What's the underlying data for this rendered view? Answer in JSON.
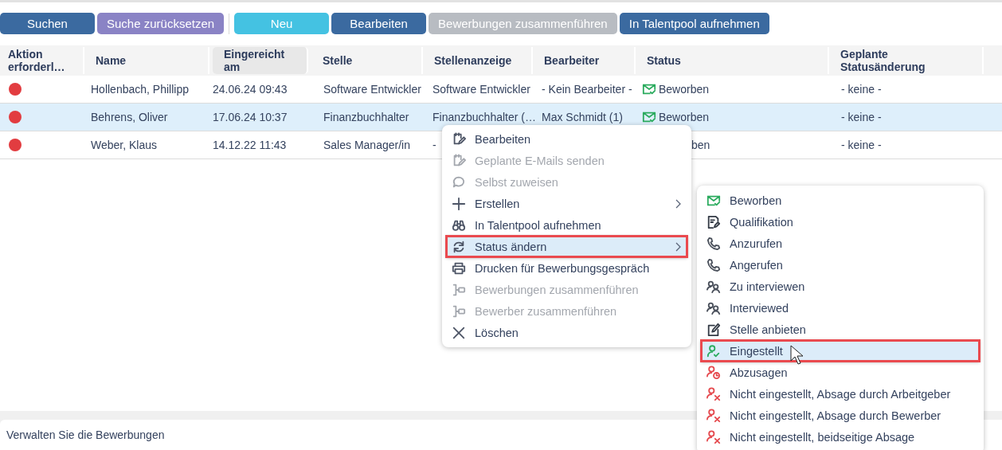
{
  "toolbar": [
    {
      "label": "Suchen",
      "kind": "primary",
      "disabled": false
    },
    {
      "label": "Suche zurücksetzen",
      "kind": "secondary",
      "disabled": false
    },
    {
      "label": "Neu",
      "kind": "accent",
      "disabled": false
    },
    {
      "label": "Bearbeiten",
      "kind": "primary",
      "disabled": false
    },
    {
      "label": "Bewerbungen zusammenführen",
      "kind": "primary",
      "disabled": true
    },
    {
      "label": "In Talentpool aufnehmen",
      "kind": "primary",
      "disabled": false
    }
  ],
  "table": {
    "columns": [
      {
        "label": "Aktion erforderl…",
        "sorted": false
      },
      {
        "label": "Name",
        "sorted": false
      },
      {
        "label": "Eingereicht am",
        "sorted": true
      },
      {
        "label": "Stelle",
        "sorted": false
      },
      {
        "label": "Stellenanzeige",
        "sorted": false
      },
      {
        "label": "Bearbeiter",
        "sorted": false
      },
      {
        "label": "Status",
        "sorted": false
      },
      {
        "label": "Geplante Statusänderung",
        "sorted": false
      }
    ],
    "rows": [
      {
        "action_required": true,
        "selected": false,
        "name": "Hollenbach, Phillipp",
        "submitted": "24.06.24 09:43",
        "position": "Software Entwickler",
        "job_ad": "Software Entwickler",
        "assignee": "- Kein Bearbeiter -",
        "status": {
          "text": "Beworben",
          "icon": true
        },
        "planned": "- keine -"
      },
      {
        "action_required": true,
        "selected": true,
        "name": "Behrens, Oliver",
        "submitted": "17.06.24 10:37",
        "position": "Finanzbuchhalter",
        "job_ad": "Finanzbuchhalter (…",
        "assignee": "Max Schmidt (1)",
        "status": {
          "text": "Beworben",
          "icon": true
        },
        "planned": "- keine -"
      },
      {
        "action_required": true,
        "selected": false,
        "name": "Weber, Klaus",
        "submitted": "14.12.22 11:43",
        "position": "Sales Manager/in",
        "job_ad": "-",
        "status": {
          "text": "ben",
          "icon": false
        },
        "planned": "- keine -"
      }
    ]
  },
  "context_menu": {
    "items": [
      {
        "label": "Bearbeiten",
        "disabled": false,
        "submenu": false,
        "selected": false
      },
      {
        "label": "Geplante E-Mails senden",
        "disabled": true,
        "submenu": false,
        "selected": false
      },
      {
        "label": "Selbst zuweisen",
        "disabled": true,
        "submenu": false,
        "selected": false
      },
      {
        "label": "Erstellen",
        "disabled": false,
        "submenu": true,
        "selected": false
      },
      {
        "label": "In Talentpool aufnehmen",
        "disabled": false,
        "submenu": false,
        "selected": false
      },
      {
        "label": "Status ändern",
        "disabled": false,
        "submenu": true,
        "selected": true
      },
      {
        "label": "Drucken für Bewerbungsgespräch",
        "disabled": false,
        "submenu": false,
        "selected": false
      },
      {
        "label": "Bewerbungen zusammenführen",
        "disabled": true,
        "submenu": false,
        "selected": false
      },
      {
        "label": "Bewerber zusammenführen",
        "disabled": true,
        "submenu": false,
        "selected": false
      },
      {
        "label": "Löschen",
        "disabled": false,
        "submenu": false,
        "selected": false
      }
    ]
  },
  "status_menu": {
    "items": [
      {
        "label": "Beworben",
        "color": "#2bab5e",
        "selected": false
      },
      {
        "label": "Qualifikation",
        "color": "#333a45",
        "selected": false
      },
      {
        "label": "Anzurufen",
        "color": "#4a505b",
        "selected": false
      },
      {
        "label": "Angerufen",
        "color": "#4a505b",
        "selected": false
      },
      {
        "label": "Zu interviewen",
        "color": "#4a505b",
        "selected": false
      },
      {
        "label": "Interviewed",
        "color": "#4a505b",
        "selected": false
      },
      {
        "label": "Stelle anbieten",
        "color": "#333a45",
        "selected": false
      },
      {
        "label": "Eingestellt",
        "color": "#2bab5e",
        "selected": true
      },
      {
        "label": "Abzusagen",
        "color": "#e5484d",
        "selected": false
      },
      {
        "label": "Nicht eingestellt, Absage durch Arbeitgeber",
        "color": "#e5484d",
        "selected": false
      },
      {
        "label": "Nicht eingestellt, Absage durch Bewerber",
        "color": "#e5484d",
        "selected": false
      },
      {
        "label": "Nicht eingestellt, beidseitige Absage",
        "color": "#e5484d",
        "selected": false
      }
    ]
  },
  "footer": {
    "text": "Verwalten Sie die Bewerbungen"
  }
}
